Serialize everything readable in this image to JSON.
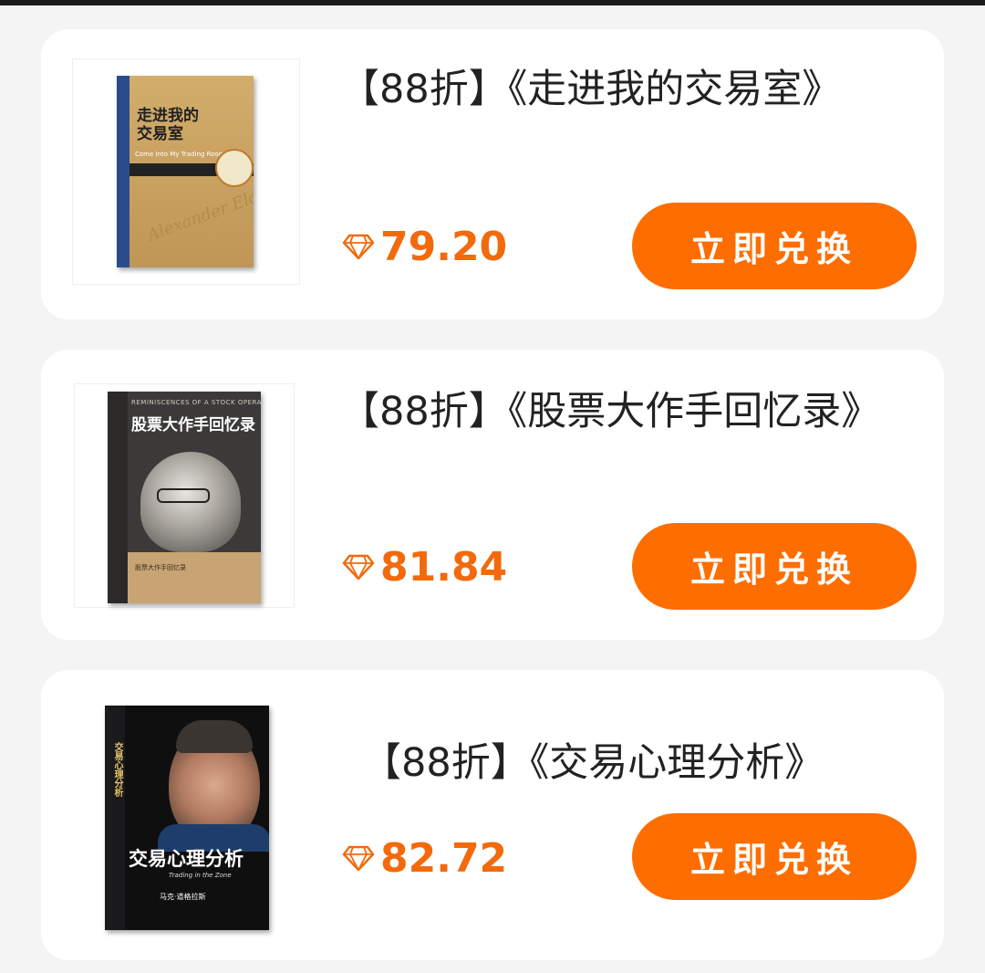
{
  "items": [
    {
      "title": "【88折】《走进我的交易室》",
      "price": "79.20",
      "button_label": "立即兑换",
      "cover": {
        "title": "走进我的交易室",
        "author": "Alexander Elder",
        "subtitle": "Come Into My Trading Room"
      }
    },
    {
      "title": "【88折】《股票大作手回忆录》",
      "price": "81.84",
      "button_label": "立即兑换",
      "cover": {
        "title": "股票大作手回忆录",
        "subtitle": "REMINISCENCES OF A STOCK OPERATOR"
      }
    },
    {
      "title": "【88折】《交易心理分析》",
      "price": "82.72",
      "button_label": "立即兑换",
      "cover": {
        "title": "交易心理分析",
        "subtitle": "Trading in the Zone",
        "author": "马克·道格拉斯"
      }
    }
  ],
  "colors": {
    "accent": "#fe6d00",
    "price": "#f26a0c",
    "card_bg": "#ffffff",
    "page_bg": "#f4f4f4"
  },
  "icons": {
    "price": "diamond-icon"
  }
}
